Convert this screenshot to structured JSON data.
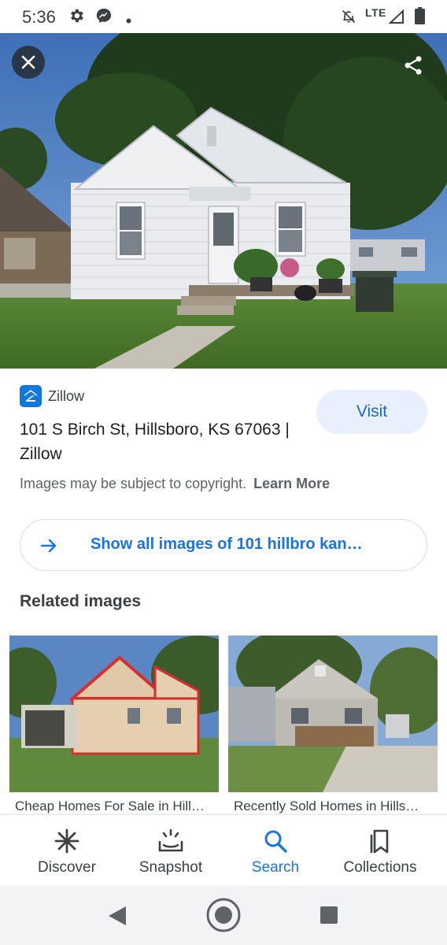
{
  "status_bar": {
    "time": "5:36",
    "network": "LTE",
    "icons": [
      "gear-icon",
      "messenger-icon",
      "dot-icon",
      "mute-icon",
      "signal-icon",
      "battery-icon"
    ]
  },
  "hero": {
    "close_icon": "close-icon",
    "share_icon": "share-icon"
  },
  "result": {
    "source_name": "Zillow",
    "title": "101 S Birch St, Hillsboro, KS 67063 | Zillow",
    "visit_label": "Visit",
    "copyright_text": "Images may be subject to copyright.",
    "learn_more": "Learn More",
    "show_all_label": "Show all images of 101 hillbro kan…"
  },
  "related": {
    "heading": "Related images",
    "items": [
      {
        "caption": "Cheap Homes For Sale in Hill…"
      },
      {
        "caption": "Recently Sold Homes in Hills…"
      }
    ]
  },
  "bottom_nav": {
    "items": [
      {
        "label": "Discover",
        "icon": "discover-icon"
      },
      {
        "label": "Snapshot",
        "icon": "snapshot-icon"
      },
      {
        "label": "Search",
        "icon": "search-icon",
        "active": true
      },
      {
        "label": "Collections",
        "icon": "collections-icon"
      }
    ]
  },
  "colors": {
    "accent": "#1a73e8",
    "visit_bg": "#e8f0fe",
    "zillow_brand": "#1277e1"
  }
}
